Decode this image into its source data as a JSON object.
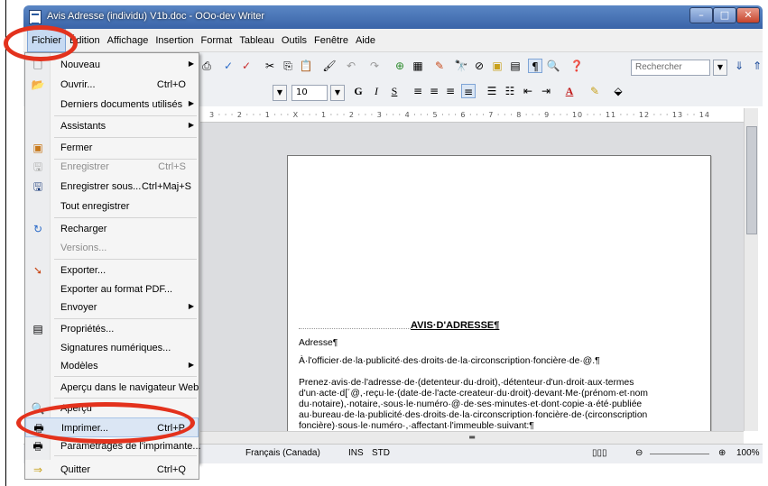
{
  "window": {
    "title": "Avis Adresse (individu) V1b.doc - OOo-dev Writer"
  },
  "menubar": [
    "Fichier",
    "Édition",
    "Affichage",
    "Insertion",
    "Format",
    "Tableau",
    "Outils",
    "Fenêtre",
    "Aide"
  ],
  "file_menu": [
    {
      "label": "Nouveau",
      "shortcut": "",
      "submenu": true,
      "disabled": false,
      "icon": "new-document-icon"
    },
    {
      "label": "Ouvrir...",
      "shortcut": "Ctrl+O",
      "submenu": false,
      "disabled": false,
      "icon": "open-folder-icon"
    },
    {
      "label": "Derniers documents utilisés",
      "shortcut": "",
      "submenu": true,
      "disabled": false,
      "icon": ""
    },
    {
      "label": "Assistants",
      "shortcut": "",
      "submenu": true,
      "disabled": false,
      "icon": ""
    },
    {
      "label": "Fermer",
      "shortcut": "",
      "submenu": false,
      "disabled": false,
      "icon": "close-document-icon"
    },
    {
      "label": "Enregistrer",
      "shortcut": "Ctrl+S",
      "submenu": false,
      "disabled": true,
      "icon": "save-icon"
    },
    {
      "label": "Enregistrer sous...",
      "shortcut": "Ctrl+Maj+S",
      "submenu": false,
      "disabled": false,
      "icon": "save-as-icon"
    },
    {
      "label": "Tout enregistrer",
      "shortcut": "",
      "submenu": false,
      "disabled": false,
      "icon": ""
    },
    {
      "label": "Recharger",
      "shortcut": "",
      "submenu": false,
      "disabled": false,
      "icon": "reload-icon"
    },
    {
      "label": "Versions...",
      "shortcut": "",
      "submenu": false,
      "disabled": true,
      "icon": ""
    },
    {
      "label": "Exporter...",
      "shortcut": "",
      "submenu": false,
      "disabled": false,
      "icon": "export-icon"
    },
    {
      "label": "Exporter au format PDF...",
      "shortcut": "",
      "submenu": false,
      "disabled": false,
      "icon": ""
    },
    {
      "label": "Envoyer",
      "shortcut": "",
      "submenu": true,
      "disabled": false,
      "icon": ""
    },
    {
      "label": "Propriétés...",
      "shortcut": "",
      "submenu": false,
      "disabled": false,
      "icon": "properties-icon"
    },
    {
      "label": "Signatures numériques...",
      "shortcut": "",
      "submenu": false,
      "disabled": false,
      "icon": ""
    },
    {
      "label": "Modèles",
      "shortcut": "",
      "submenu": true,
      "disabled": false,
      "icon": ""
    },
    {
      "label": "Aperçu dans le navigateur Web",
      "shortcut": "",
      "submenu": false,
      "disabled": false,
      "icon": ""
    },
    {
      "label": "Aperçu",
      "shortcut": "",
      "submenu": false,
      "disabled": false,
      "icon": "preview-icon"
    },
    {
      "label": "Imprimer...",
      "shortcut": "Ctrl+P",
      "submenu": false,
      "disabled": false,
      "icon": "print-icon"
    },
    {
      "label": "Paramétrages de l'imprimante...",
      "shortcut": "",
      "submenu": false,
      "disabled": false,
      "icon": "printer-settings-icon"
    },
    {
      "label": "Quitter",
      "shortcut": "Ctrl+Q",
      "submenu": false,
      "disabled": false,
      "icon": "exit-icon"
    }
  ],
  "toolbar": {
    "search_placeholder": "Rechercher",
    "font_size": "10"
  },
  "ruler_text": "3 · · · 2 · · · 1 · · · X · · · 1 · · · 2 · · · 3 · · · 4 · · · 5 · · · 6 · · · 7 · · · 8 · · · 9 · · · 10 · · · 11 · · · 12 · · · 13 · · 14",
  "document": {
    "heading": "AVIS·D'ADRESSE¶",
    "p1": "Adresse¶",
    "p2": "À·l'officier·de·la·publicité·des·droits·de·la·circonscription·foncière·de·@.¶",
    "p3": "Prenez·avis·de·l'adresse·de·(detenteur·du·droit),·détenteur·d'un·droit·aux·termes d'un·acte·d[´@,·reçu·le·(date·de·l'acte·createur·du·droit)·devant·Me·(prénom·et·nom du·notaire),·notaire,·sous·le·numéro·@·de·ses·minutes·et·dont·copie·a·été·publiée au·bureau·de·la·publicité·des·droits·de·la·circonscription·foncière·de·(circonscription foncière)·sous·le·numéro·,·affectant·l'immeuble·suivant:¶"
  },
  "statusbar": {
    "language": "Français (Canada)",
    "ins": "INS",
    "std": "STD",
    "zoom": "100%"
  },
  "colors": {
    "annotation": "#e3321d",
    "titlebar": "#3a64a8"
  }
}
